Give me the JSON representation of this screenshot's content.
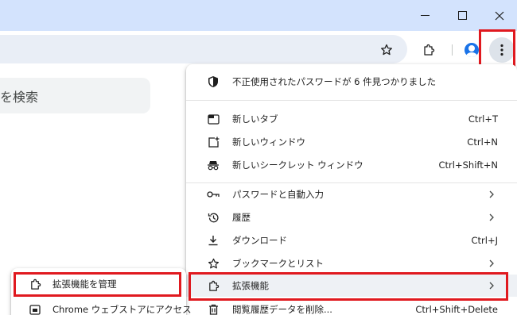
{
  "page": {
    "search_placeholder": "を検索"
  },
  "menu": {
    "items": [
      {
        "label": "不正使用されたパスワードが 6 件見つかりました",
        "icon": "shield-icon"
      },
      {
        "label": "新しいタブ",
        "shortcut": "Ctrl+T",
        "icon": "new-tab-icon"
      },
      {
        "label": "新しいウィンドウ",
        "shortcut": "Ctrl+N",
        "icon": "new-window-icon"
      },
      {
        "label": "新しいシークレット ウィンドウ",
        "shortcut": "Ctrl+Shift+N",
        "icon": "incognito-icon"
      },
      {
        "label": "パスワードと自動入力",
        "icon": "key-icon",
        "submenu": true
      },
      {
        "label": "履歴",
        "icon": "history-icon",
        "submenu": true
      },
      {
        "label": "ダウンロード",
        "shortcut": "Ctrl+J",
        "icon": "download-icon"
      },
      {
        "label": "ブックマークとリスト",
        "icon": "bookmark-star-icon",
        "submenu": true
      },
      {
        "label": "拡張機能",
        "icon": "extension-icon",
        "submenu": true
      },
      {
        "label": "閲覧履歴データを削除...",
        "shortcut": "Ctrl+Shift+Delete",
        "icon": "trash-icon"
      }
    ]
  },
  "submenu": {
    "items": [
      {
        "label": "拡張機能を管理",
        "icon": "extension-icon"
      },
      {
        "label": "Chrome ウェブストアにアクセス",
        "icon": "webstore-icon"
      }
    ]
  },
  "colors": {
    "titlebar": "#d3e3fd",
    "highlight": "#e0191f",
    "omnibox": "#e9eef6",
    "avatar": "#1a73e8"
  }
}
